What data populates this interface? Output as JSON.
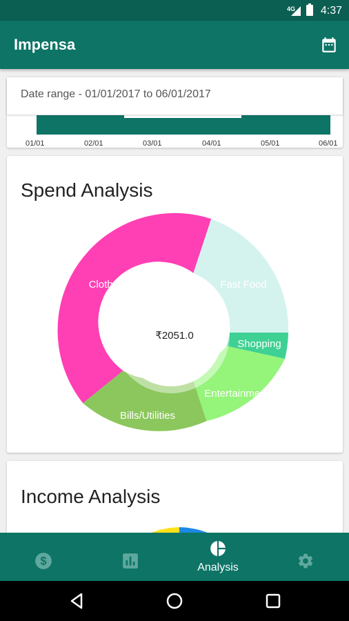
{
  "status_bar": {
    "network": "4G",
    "time": "4:37"
  },
  "app_bar": {
    "title": "Impensa",
    "calendar_icon": "calendar-icon"
  },
  "date_range": {
    "label": "Date range - 01/01/2017 to 06/01/2017",
    "ticks": [
      "01/01",
      "02/01",
      "03/01",
      "04/01",
      "05/01",
      "06/01"
    ],
    "bar_color": "#0d7466"
  },
  "spend_analysis": {
    "title": "Spend Analysis",
    "total": "₹2051.0",
    "segments": [
      {
        "label": "Clothes",
        "color": "#ff3fb4"
      },
      {
        "label": "Fast Food",
        "color": "#d4f3ee"
      },
      {
        "label": "Shopping",
        "color": "#3ed193"
      },
      {
        "label": "Entertainment",
        "color": "#95f47a"
      },
      {
        "label": "Bills/Utilities",
        "color": "#8bc75c"
      }
    ]
  },
  "income_analysis": {
    "title": "Income Analysis"
  },
  "bottom_nav": {
    "items": [
      {
        "icon": "dollar-icon",
        "label": ""
      },
      {
        "icon": "bar-chart-icon",
        "label": ""
      },
      {
        "icon": "pie-chart-icon",
        "label": "Analysis"
      },
      {
        "icon": "gear-icon",
        "label": ""
      }
    ],
    "active_index": 2
  },
  "colors": {
    "primary": "#0d7466",
    "primary_dark": "#0a5f52",
    "nav_inactive": "#5fa89d"
  }
}
